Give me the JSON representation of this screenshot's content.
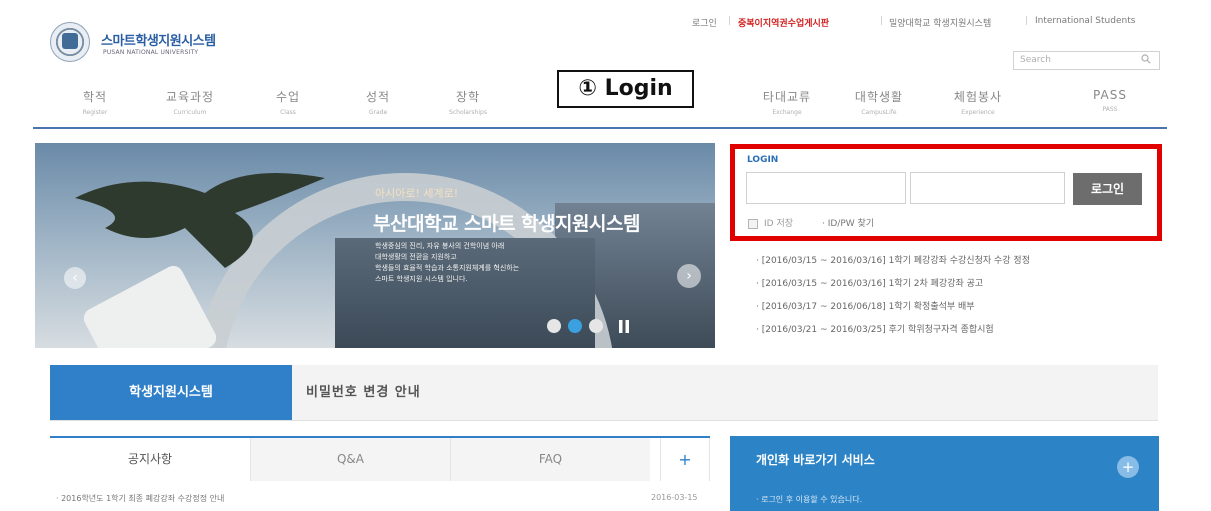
{
  "header": {
    "logo_title": "스마트학생지원시스템",
    "logo_subtitle": "PUSAN NATIONAL UNIVERSITY",
    "util_links": {
      "login": "로그인",
      "notice": "중복이지역권수업게시판",
      "milyang": "밀양대학교 학생지원시스템",
      "intl": "International Students"
    },
    "search": {
      "placeholder": "Search"
    }
  },
  "nav": [
    {
      "ko": "학적",
      "en": "Register"
    },
    {
      "ko": "교육과정",
      "en": "Curriculum"
    },
    {
      "ko": "수업",
      "en": "Class"
    },
    {
      "ko": "성적",
      "en": "Grade"
    },
    {
      "ko": "장학",
      "en": "Scholarships"
    },
    {
      "ko": "타대교류",
      "en": "Exchange"
    },
    {
      "ko": "대학생활",
      "en": "CampusLife"
    },
    {
      "ko": "체험봉사",
      "en": "Experience"
    },
    {
      "ko": "PASS",
      "en": "PASS"
    }
  ],
  "callout": {
    "label": "① Login"
  },
  "banner": {
    "subtitle": "아시아로! 세계로!",
    "title": "부산대학교 스마트 학생지원시스템",
    "desc": [
      "학생중심의 진리, 자유 봉사의 건학이념 아래",
      "대학생활의 전환을 지원하고",
      "학생들의 효율적 학습과 소통지원체계를 혁신하는",
      "스마트 학생지원 시스템 입니다."
    ]
  },
  "login": {
    "label": "LOGIN",
    "button": "로그인",
    "id_save": "ID 저장",
    "find": "· ID/PW 찾기"
  },
  "news": [
    "· [2016/03/15 ~ 2016/03/16] 1학기 폐강강좌 수강신청자 수강 정정",
    "· [2016/03/15 ~ 2016/03/16] 1학기 2차 폐강강좌 공고",
    "· [2016/03/17 ~ 2016/06/18] 1학기 확정출석부 배부",
    "· [2016/03/21 ~ 2016/03/25] 후기 학위청구자격 종합시험"
  ],
  "tabs": {
    "active": "학생지원시스템",
    "password": "비밀번호 변경 안내"
  },
  "notice_tabs": [
    "공지사항",
    "Q&A",
    "FAQ",
    "+"
  ],
  "notice_row": {
    "text": "· 2016학년도 1학기 최종 폐강강좌 수강정정 안내",
    "date": "2016-03-15"
  },
  "personal": {
    "title": "개인화 바로가기 서비스",
    "plus": "+",
    "item": "· 로그인 후 이용할 수 있습니다."
  }
}
